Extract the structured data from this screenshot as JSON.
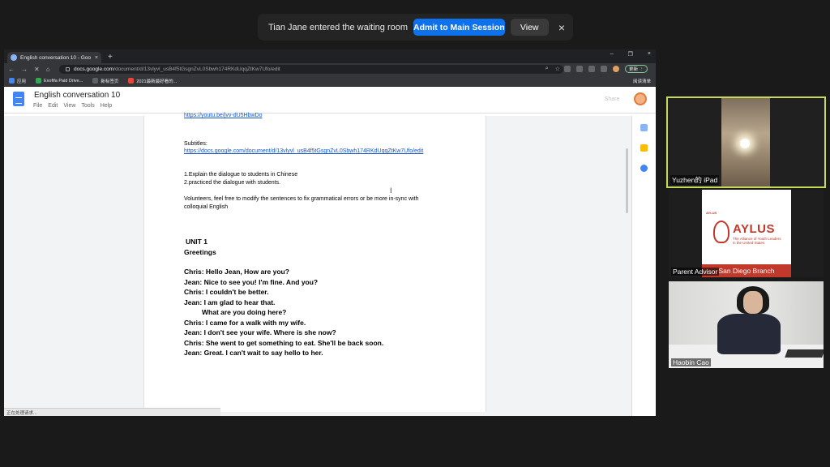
{
  "zoom_notification": {
    "message": "Tian Jane entered the waiting room",
    "admit_label": "Admit to Main Session",
    "view_label": "View",
    "close_glyph": "×"
  },
  "browser": {
    "tab_title": "English conversation 10 - Goo",
    "tab_close": "×",
    "new_tab": "+",
    "window_controls": [
      "–",
      "❐",
      "×"
    ],
    "url_host": "docs.google.com",
    "url_path": "/document/d/13vlyvl_usB4f5tGsgnZvL0Sbwh174RKdUqqZtKw7Ufo/edit",
    "update_label": "更新 ⋮",
    "bookmarks": [
      {
        "label": "应用",
        "color": "#4285f4"
      },
      {
        "label": "Exofifa Paid Drive...",
        "color": "#34a853"
      },
      {
        "label": "新标签页",
        "color": "#5f6368"
      },
      {
        "label": "2021最新最好看的...",
        "color": "#e8453c"
      }
    ],
    "reading_list": "阅读清单",
    "status_text": "正在处理请求..."
  },
  "docs": {
    "title": "English conversation 10",
    "menu": [
      "File",
      "Edit",
      "View",
      "Tools",
      "Help"
    ],
    "share_label": "Share",
    "content": {
      "top_link": "https://youtu.be/jvv-dU5HbwDo",
      "subtitles_label": "Subtitles:",
      "subtitles_link": "https://docs.google.com/document/d/13vlyvl_usB4f5tGsgnZvL0Sbwh174RKdUqqZtKw7Ufo/edit",
      "step1": "1.Explain the dialogue to students in Chinese",
      "step2": "2.practiced the dialogue with students.",
      "volunteers_1": "Volunteers, feel free to modify the sentences to fix grammatical errors or be more in-sync with",
      "volunteers_2": "colloquial English",
      "unit": "UNIT 1",
      "unit_title": "Greetings",
      "dialogue": [
        "Chris: Hello Jean, How are you?",
        "Jean: Nice to see you! I'm fine. And you?",
        "Chris: I couldn't be better.",
        "Jean: I am glad to hear that.",
        "What are you doing here?",
        "Chris: I came for a walk with my wife.",
        "Jean: I don't see your wife. Where is she now?",
        "Chris: She went to get something to eat. She'll be back soon.",
        "Jean: Great. I can't wait to say hello to her."
      ]
    }
  },
  "participants": [
    {
      "name": "Yuzhen的 iPad"
    },
    {
      "name": "Parent Advisor",
      "logo": {
        "top": "AYLUS",
        "wordmark": "AYLUS",
        "subtitle": "The Alliance of Youth Leaders in the United States",
        "branch": "San Diego Branch"
      }
    },
    {
      "name": "Haobin Cao"
    }
  ],
  "colors": {
    "admit_blue": "#0e72ed",
    "active_speaker": "#c8d95a",
    "aylus_red": "#c0392b",
    "docs_blue": "#4285f4"
  }
}
